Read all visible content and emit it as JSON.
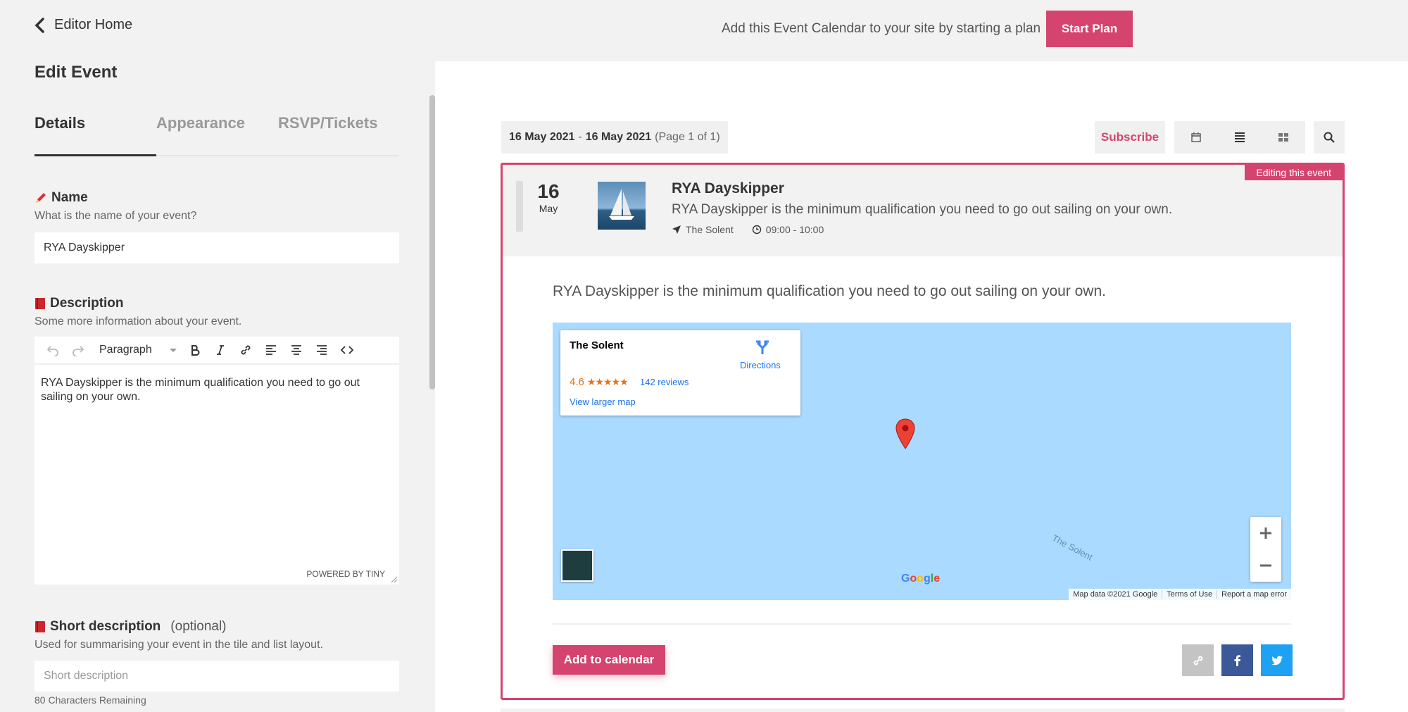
{
  "sidebar": {
    "back_label": "Editor Home",
    "title": "Edit Event",
    "tabs": [
      {
        "label": "Details"
      },
      {
        "label": "Appearance"
      },
      {
        "label": "RSVP/Tickets"
      }
    ],
    "name_field": {
      "label": "Name",
      "help": "What is the name of your event?",
      "value": "RYA Dayskipper"
    },
    "description_field": {
      "label": "Description",
      "help": "Some more information about your event.",
      "format_select": "Paragraph",
      "content": "RYA Dayskipper is the minimum qualification you need to go out sailing on your own.",
      "powered_by": "POWERED BY TINY"
    },
    "short_description_field": {
      "label": "Short description",
      "optional": "(optional)",
      "help": "Used for summarising your event in the tile and list layout.",
      "placeholder": "Short description",
      "remaining": "80 Characters Remaining"
    }
  },
  "topbar": {
    "message": "Add this Event Calendar to your site by starting a plan",
    "start_plan": "Start Plan"
  },
  "calendar": {
    "date_from": "16 May 2021",
    "date_sep": "-",
    "date_to": "16 May 2021",
    "page_info": "(Page 1 of 1)",
    "subscribe": "Subscribe",
    "event": {
      "badge": "Editing this event",
      "day": "16",
      "month": "May",
      "title": "RYA Dayskipper",
      "summary": "RYA Dayskipper is the minimum qualification you need to go out sailing on your own.",
      "location": "The Solent",
      "time": "09:00 - 10:00",
      "body": "RYA Dayskipper is the minimum qualification you need to go out sailing on your own.",
      "add_to_calendar": "Add to calendar"
    },
    "map": {
      "place": "The Solent",
      "rating": "4.6",
      "stars": "★★★★★",
      "reviews": "142 reviews",
      "directions": "Directions",
      "larger_map": "View larger map",
      "water_label": "The Solent",
      "google": "Google",
      "footer": [
        "Map data ©2021 Google",
        "Terms of Use",
        "Report a map error"
      ]
    }
  },
  "colors": {
    "accent": "#d4446e",
    "map_water": "#aadaff",
    "facebook": "#3b5998",
    "twitter": "#1da1f2"
  }
}
